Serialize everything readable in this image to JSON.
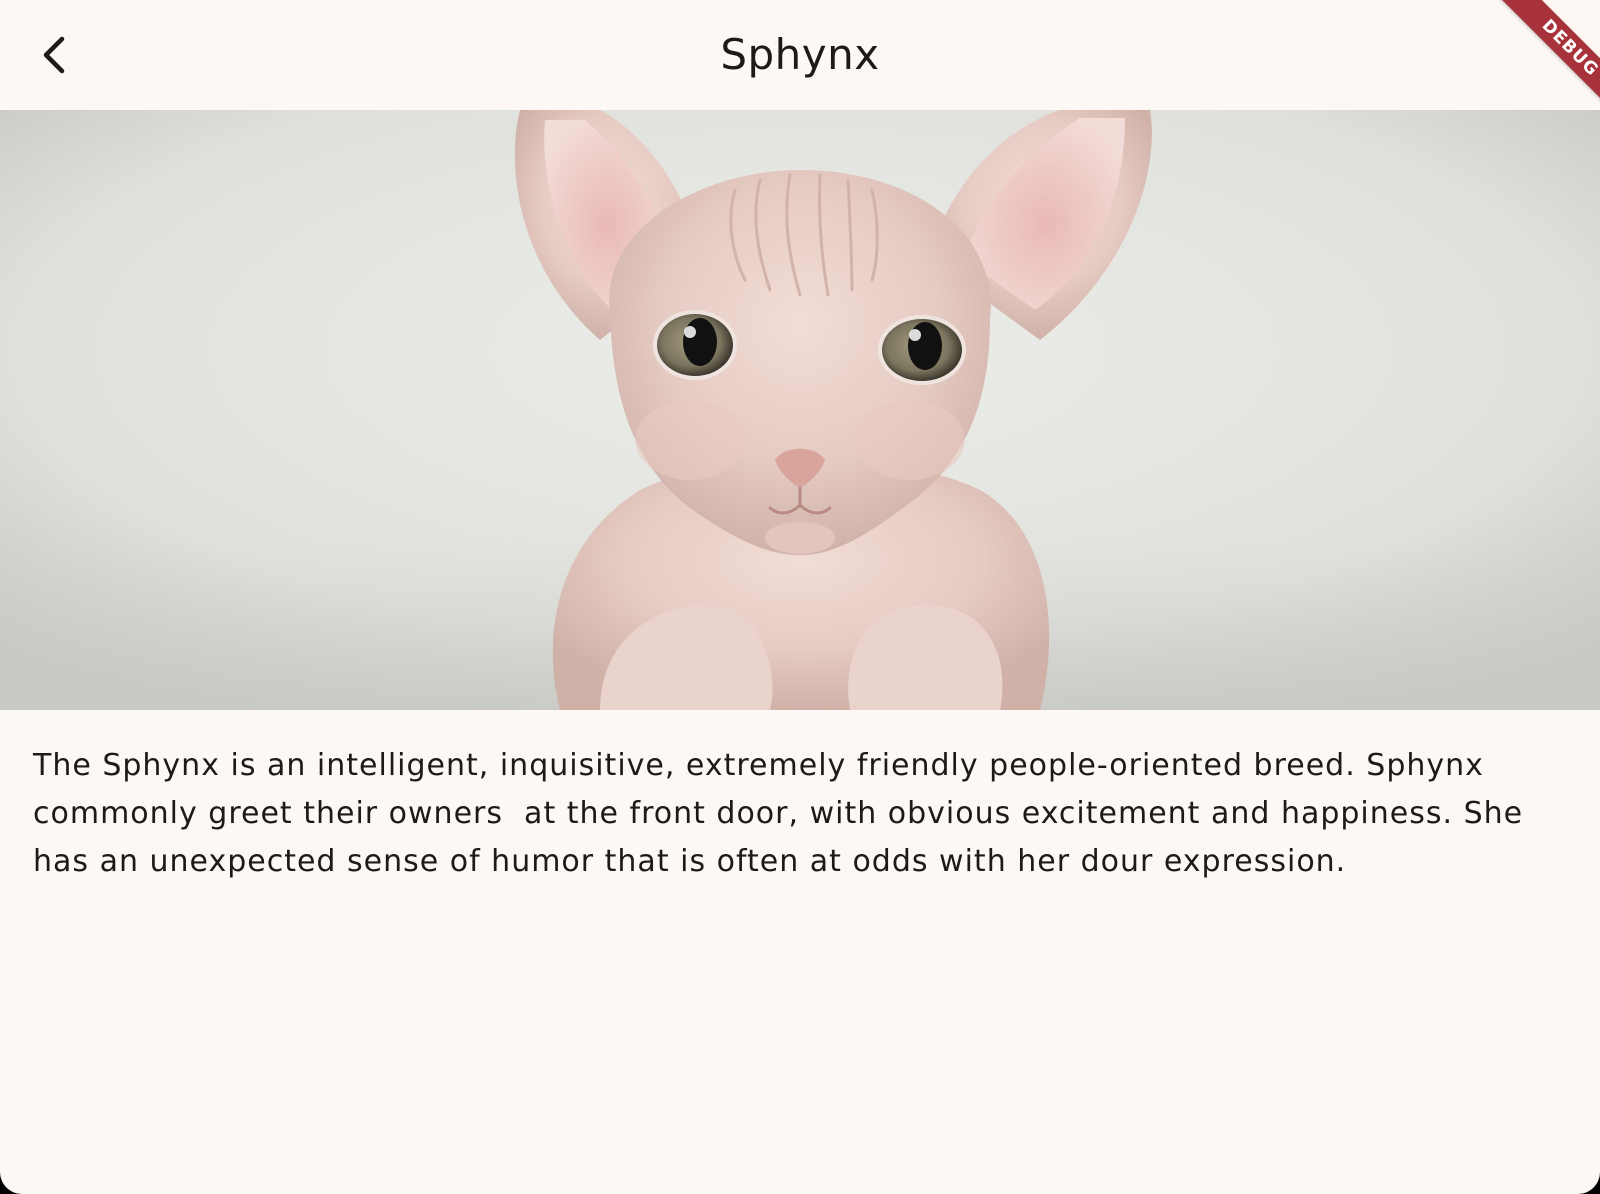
{
  "app_bar": {
    "title": "Sphynx",
    "back_icon": "chevron-left-icon"
  },
  "debug_banner": {
    "label": "DEBUG",
    "color": "#a8323a"
  },
  "hero_image": {
    "subject": "sphynx-cat-photo"
  },
  "description": {
    "lines": [
      "The Sphynx is an intelligent, inquisitive, extremely friendly people-oriented breed. Sphynx",
      "commonly greet their owners  at the front door, with obvious excitement and happiness. She",
      "has an unexpected sense of humor that is often at odds with her dour expression."
    ]
  },
  "colors": {
    "background": "#fdf8f5",
    "text": "#1d1b1a"
  }
}
